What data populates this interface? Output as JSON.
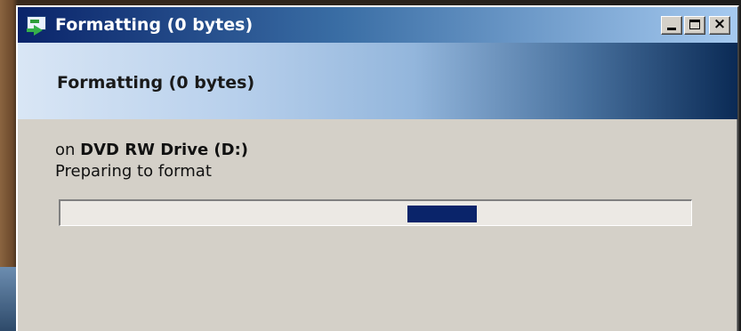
{
  "window": {
    "title": "Formatting (0 bytes)",
    "icon": "format-drive-icon",
    "controls": {
      "minimize": "minimize-icon",
      "maximize": "maximize-icon",
      "close": "×"
    }
  },
  "header": {
    "title": "Formatting (0 bytes)"
  },
  "details": {
    "location_prefix": "on ",
    "drive_name": "DVD RW Drive (D:)",
    "status": "Preparing to format"
  },
  "progress": {
    "mode": "marquee",
    "chunk_position": 0.55,
    "bar_color": "#0a246a"
  },
  "colors": {
    "titlebar_start": "#0a246a",
    "titlebar_end": "#a6caf0",
    "window_face": "#d4d0c8"
  }
}
